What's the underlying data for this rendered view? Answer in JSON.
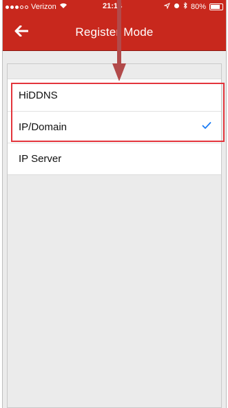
{
  "status_bar": {
    "carrier": "Verizon",
    "time": "21:14",
    "battery": "80%"
  },
  "nav": {
    "title": "Register Mode"
  },
  "options": [
    {
      "label": "HiDDNS",
      "selected": false
    },
    {
      "label": "IP/Domain",
      "selected": true
    },
    {
      "label": "IP Server",
      "selected": false
    }
  ],
  "colors": {
    "nav_bg": "#c8281d",
    "check": "#1a7cf5",
    "annotation": "#e3343b"
  }
}
